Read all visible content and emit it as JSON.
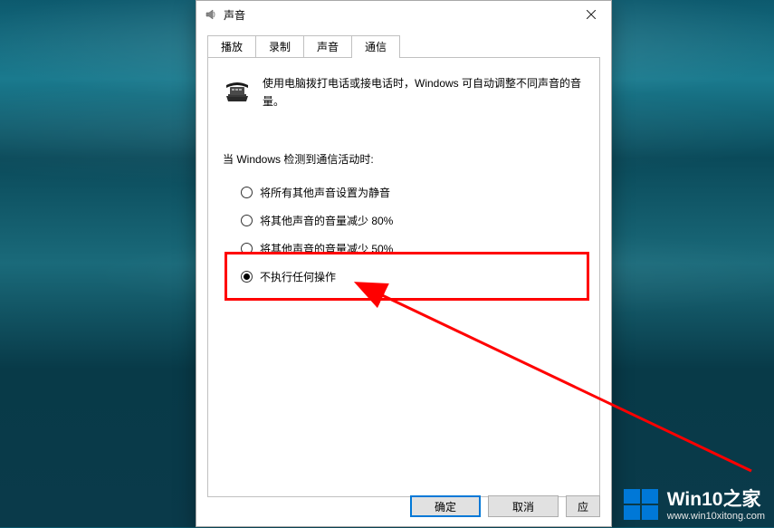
{
  "window": {
    "title": "声音"
  },
  "tabs": {
    "items": [
      "播放",
      "录制",
      "声音",
      "通信"
    ],
    "activeIndex": 3
  },
  "panel": {
    "description": "使用电脑拨打电话或接电话时，Windows 可自动调整不同声音的音量。",
    "sectionLabel": "当 Windows 检测到通信活动时:"
  },
  "radios": {
    "options": [
      {
        "label": "将所有其他声音设置为静音",
        "checked": false
      },
      {
        "label": "将其他声音的音量减少 80%",
        "checked": false
      },
      {
        "label": "将其他声音的音量减少 50%",
        "checked": false
      },
      {
        "label": "不执行任何操作",
        "checked": true
      }
    ]
  },
  "buttons": {
    "ok": "确定",
    "cancel": "取消",
    "apply": "应"
  },
  "watermark": {
    "title_prefix": "Win10",
    "title_suffix": "之家",
    "url": "www.win10xitong.com"
  },
  "annotation": {
    "highlight_color": "#ff0000"
  }
}
